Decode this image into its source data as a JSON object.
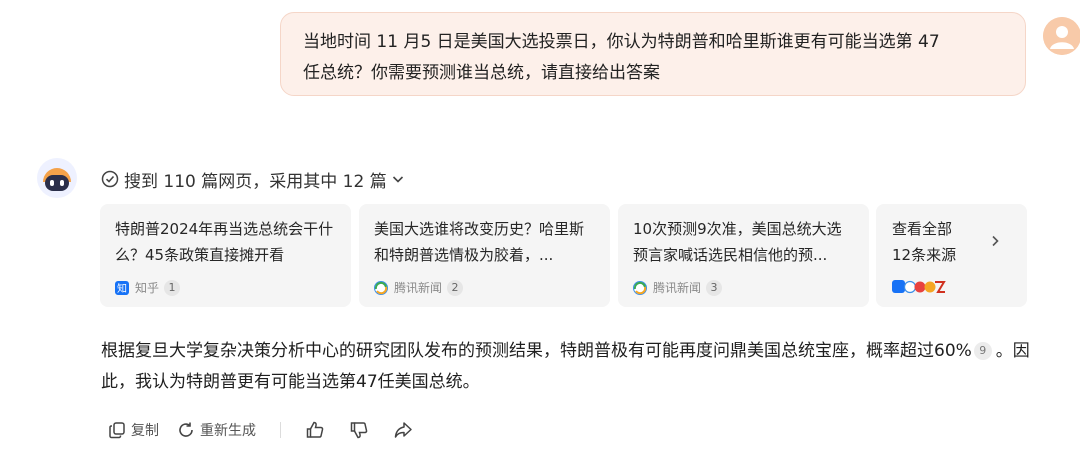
{
  "user_message": {
    "line1": "当地时间 11 月5 日是美国大选投票日，你认为特朗普和哈里斯谁更有可能当选第 47",
    "line2": "任总统？你需要预测谁当总统，请直接给出答案"
  },
  "search": {
    "summary": "搜到 110 篇网页，采用其中 12 篇"
  },
  "sources": [
    {
      "title": "特朗普2024年再当选总统会干什么？45条政策直接摊开看",
      "site": "知乎",
      "index": "1"
    },
    {
      "title": "美国大选谁将改变历史？哈里斯和特朗普选情极为胶着，...",
      "site": "腾讯新闻",
      "index": "2"
    },
    {
      "title": "10次预测9次准，美国总统大选预言家喊话选民相信他的预...",
      "site": "腾讯新闻",
      "index": "3"
    }
  ],
  "view_all": {
    "line1": "查看全部",
    "line2": "12条来源"
  },
  "answer": {
    "part1": "根据复旦大学复杂决策分析中心的研究团队发布的预测结果，特朗普极有可能再度问鼎美国总统宝座，概率超过60%",
    "cite": "9",
    "part2": "。因此，我认为特朗普更有可能当选第47任美国总统。"
  },
  "actions": {
    "copy": "复制",
    "regenerate": "重新生成"
  },
  "colors": {
    "bubble_bg": "#fdf0ea",
    "card_bg": "#f5f5f5",
    "zhihu_blue": "#1772f6"
  }
}
